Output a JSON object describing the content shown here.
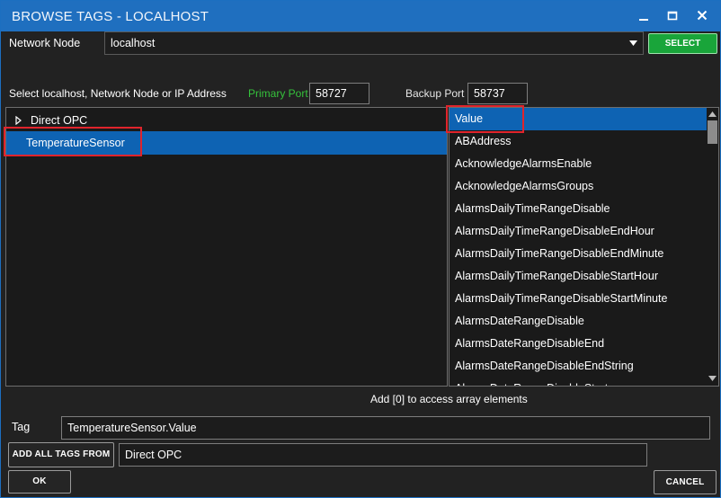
{
  "window": {
    "title": "BROWSE TAGS - LOCALHOST",
    "minimize_label": "",
    "maximize_label": "",
    "close_label": ""
  },
  "network": {
    "label": "Network Node",
    "value": "localhost",
    "select_button": "SELECT"
  },
  "ports": {
    "hint": "Select localhost, Network Node or IP Address",
    "primary_label": "Primary Port",
    "primary_value": "58727",
    "backup_label": "Backup Port",
    "backup_value": "58737"
  },
  "tree": {
    "items": [
      {
        "label": "Direct OPC",
        "expandable": true,
        "selected": false
      },
      {
        "label": "TemperatureSensor",
        "expandable": false,
        "selected": true
      }
    ]
  },
  "members": {
    "items": [
      "Value",
      "ABAddress",
      "AcknowledgeAlarmsEnable",
      "AcknowledgeAlarmsGroups",
      "AlarmsDailyTimeRangeDisable",
      "AlarmsDailyTimeRangeDisableEndHour",
      "AlarmsDailyTimeRangeDisableEndMinute",
      "AlarmsDailyTimeRangeDisableStartHour",
      "AlarmsDailyTimeRangeDisableStartMinute",
      "AlarmsDateRangeDisable",
      "AlarmsDateRangeDisableEnd",
      "AlarmsDateRangeDisableEndString",
      "AlarmsDateRangeDisableStart"
    ],
    "selected_index": 0
  },
  "hint_array": "Add [0] to access array elements",
  "tag": {
    "label": "Tag",
    "value": "TemperatureSensor.Value"
  },
  "add_all": {
    "button": "ADD ALL TAGS FROM",
    "value": "Direct OPC"
  },
  "footer": {
    "ok": "OK",
    "cancel": "CANCEL"
  },
  "colors": {
    "accent": "#1f6fbf",
    "selection": "#0e63b3",
    "select_button": "#19a53a",
    "primary_port_label": "#35c23c",
    "highlight_box": "#e0242c"
  }
}
